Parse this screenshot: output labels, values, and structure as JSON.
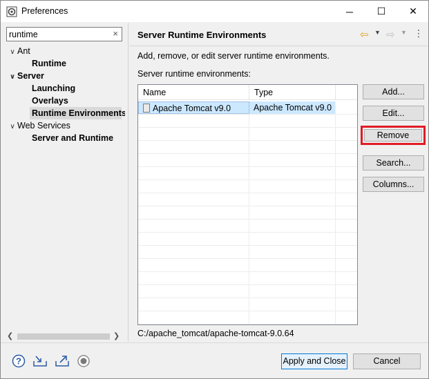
{
  "window": {
    "title": "Preferences"
  },
  "titlebar": {
    "minimize": "─",
    "maximize": "☐",
    "close": "✕"
  },
  "filter": {
    "value": "runtime",
    "clear_icon": "×"
  },
  "tree": [
    {
      "label": "Ant",
      "expanded": true,
      "bold": false
    },
    {
      "label": "Runtime",
      "bold": true
    },
    {
      "label": "Server",
      "expanded": true,
      "bold": true
    },
    {
      "label": "Launching",
      "bold": true
    },
    {
      "label": "Overlays",
      "bold": true
    },
    {
      "label": "Runtime Environments",
      "bold": true,
      "selected": true
    },
    {
      "label": "Web Services",
      "expanded": true,
      "bold": false
    },
    {
      "label": "Server and Runtime",
      "bold": true
    }
  ],
  "page": {
    "title": "Server Runtime Environments",
    "description": "Add, remove, or edit server runtime environments.",
    "list_label": "Server runtime environments:",
    "path": "C:/apache_tomcat/apache-tomcat-9.0.64"
  },
  "table": {
    "columns": [
      "Name",
      "Type"
    ],
    "rows": [
      {
        "name": "Apache Tomcat v9.0",
        "type": "Apache Tomcat v9.0",
        "selected": true
      }
    ]
  },
  "buttons": {
    "add": "Add...",
    "edit": "Edit...",
    "remove": "Remove",
    "search": "Search...",
    "columns": "Columns..."
  },
  "footer": {
    "apply_close": "Apply and Close",
    "cancel": "Cancel"
  },
  "colors": {
    "highlight_frame": "#e01b24",
    "selection": "#cce8ff",
    "default_button_border": "#0078d7"
  }
}
